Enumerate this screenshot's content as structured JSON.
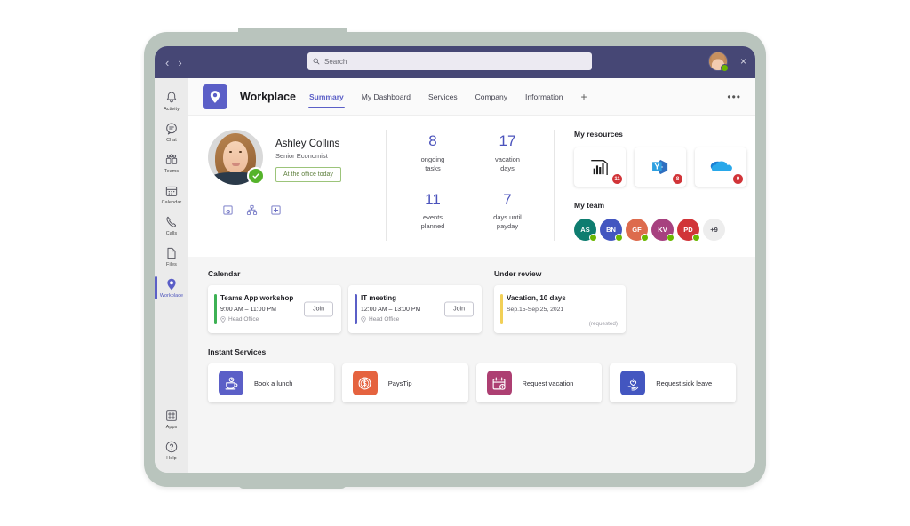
{
  "titlebar": {
    "back_label": "‹",
    "forward_label": "›",
    "search_placeholder": "Search",
    "close_label": "×"
  },
  "rail": {
    "items": [
      {
        "label": "Activity",
        "icon": "bell-icon"
      },
      {
        "label": "Chat",
        "icon": "chat-icon"
      },
      {
        "label": "Teams",
        "icon": "teams-icon"
      },
      {
        "label": "Calendar",
        "icon": "calendar-icon"
      },
      {
        "label": "Calls",
        "icon": "phone-icon"
      },
      {
        "label": "Files",
        "icon": "file-icon"
      },
      {
        "label": "Workplace",
        "icon": "pin-icon"
      }
    ],
    "bottom_items": [
      {
        "label": "Apps",
        "icon": "apps-icon"
      },
      {
        "label": "Help",
        "icon": "help-icon"
      }
    ],
    "active": "Workplace"
  },
  "app_header": {
    "title": "Workplace",
    "tabs": [
      {
        "label": "Summary",
        "active": true
      },
      {
        "label": "My Dashboard",
        "active": false
      },
      {
        "label": "Services",
        "active": false
      },
      {
        "label": "Company",
        "active": false
      },
      {
        "label": "Information",
        "active": false
      }
    ],
    "add_tab_label": "+",
    "more_label": "•••"
  },
  "profile": {
    "name": "Ashley Collins",
    "role": "Senior Economist",
    "status": "At the office today",
    "quick_icons": [
      "org-add-icon",
      "org-chart-icon",
      "add-note-icon"
    ]
  },
  "stats": [
    {
      "value": "8",
      "caption": "ongoing\ntasks",
      "line1": "ongoing",
      "line2": "tasks"
    },
    {
      "value": "17",
      "caption": "vacation days",
      "line1": "vacation",
      "line2": "days"
    },
    {
      "value": "11",
      "caption": "events planned",
      "line1": "events",
      "line2": "planned"
    },
    {
      "value": "7",
      "caption": "days until payday",
      "line1": "days until",
      "line2": "payday"
    }
  ],
  "resources": {
    "title": "My resources",
    "items": [
      {
        "name": "Power BI",
        "icon": "power-bi-icon",
        "badge": "11"
      },
      {
        "name": "Yammer",
        "icon": "yammer-icon",
        "badge": "8"
      },
      {
        "name": "OneDrive",
        "icon": "onedrive-icon",
        "badge": "9"
      }
    ]
  },
  "team": {
    "title": "My team",
    "members": [
      {
        "initials": "AS",
        "color": "#0e7d70"
      },
      {
        "initials": "BN",
        "color": "#4356c0"
      },
      {
        "initials": "GF",
        "color": "#dd6b4d"
      },
      {
        "initials": "KV",
        "color": "#a7417f"
      },
      {
        "initials": "PD",
        "color": "#d13438"
      }
    ],
    "overflow": "+9"
  },
  "calendar": {
    "title": "Calendar",
    "events": [
      {
        "title": "Teams App workshop",
        "time": "9:00 AM – 11:00 PM",
        "location": "Head Office",
        "join_label": "Join",
        "accent": "#3db154"
      },
      {
        "title": "IT meeting",
        "time": "12:00 AM – 13:00 PM",
        "location": "Head Office",
        "join_label": "Join",
        "accent": "#5b5fc7"
      }
    ]
  },
  "under_review": {
    "title": "Under review",
    "items": [
      {
        "title": "Vacation, 10 days",
        "dates": "Sep.15-Sep.25, 2021",
        "status": "(requested)",
        "accent": "#f2d057"
      }
    ]
  },
  "instant_services": {
    "title": "Instant Services",
    "items": [
      {
        "label": "Book a lunch",
        "icon": "coffee-icon",
        "color": "#5b5fc7"
      },
      {
        "label": "PaysTip",
        "icon": "money-icon",
        "color": "#e5633f"
      },
      {
        "label": "Request vacation",
        "icon": "calendar-add-icon",
        "color": "#ad3f72"
      },
      {
        "label": "Request sick leave",
        "icon": "care-heart-icon",
        "color": "#4356c0"
      }
    ]
  }
}
